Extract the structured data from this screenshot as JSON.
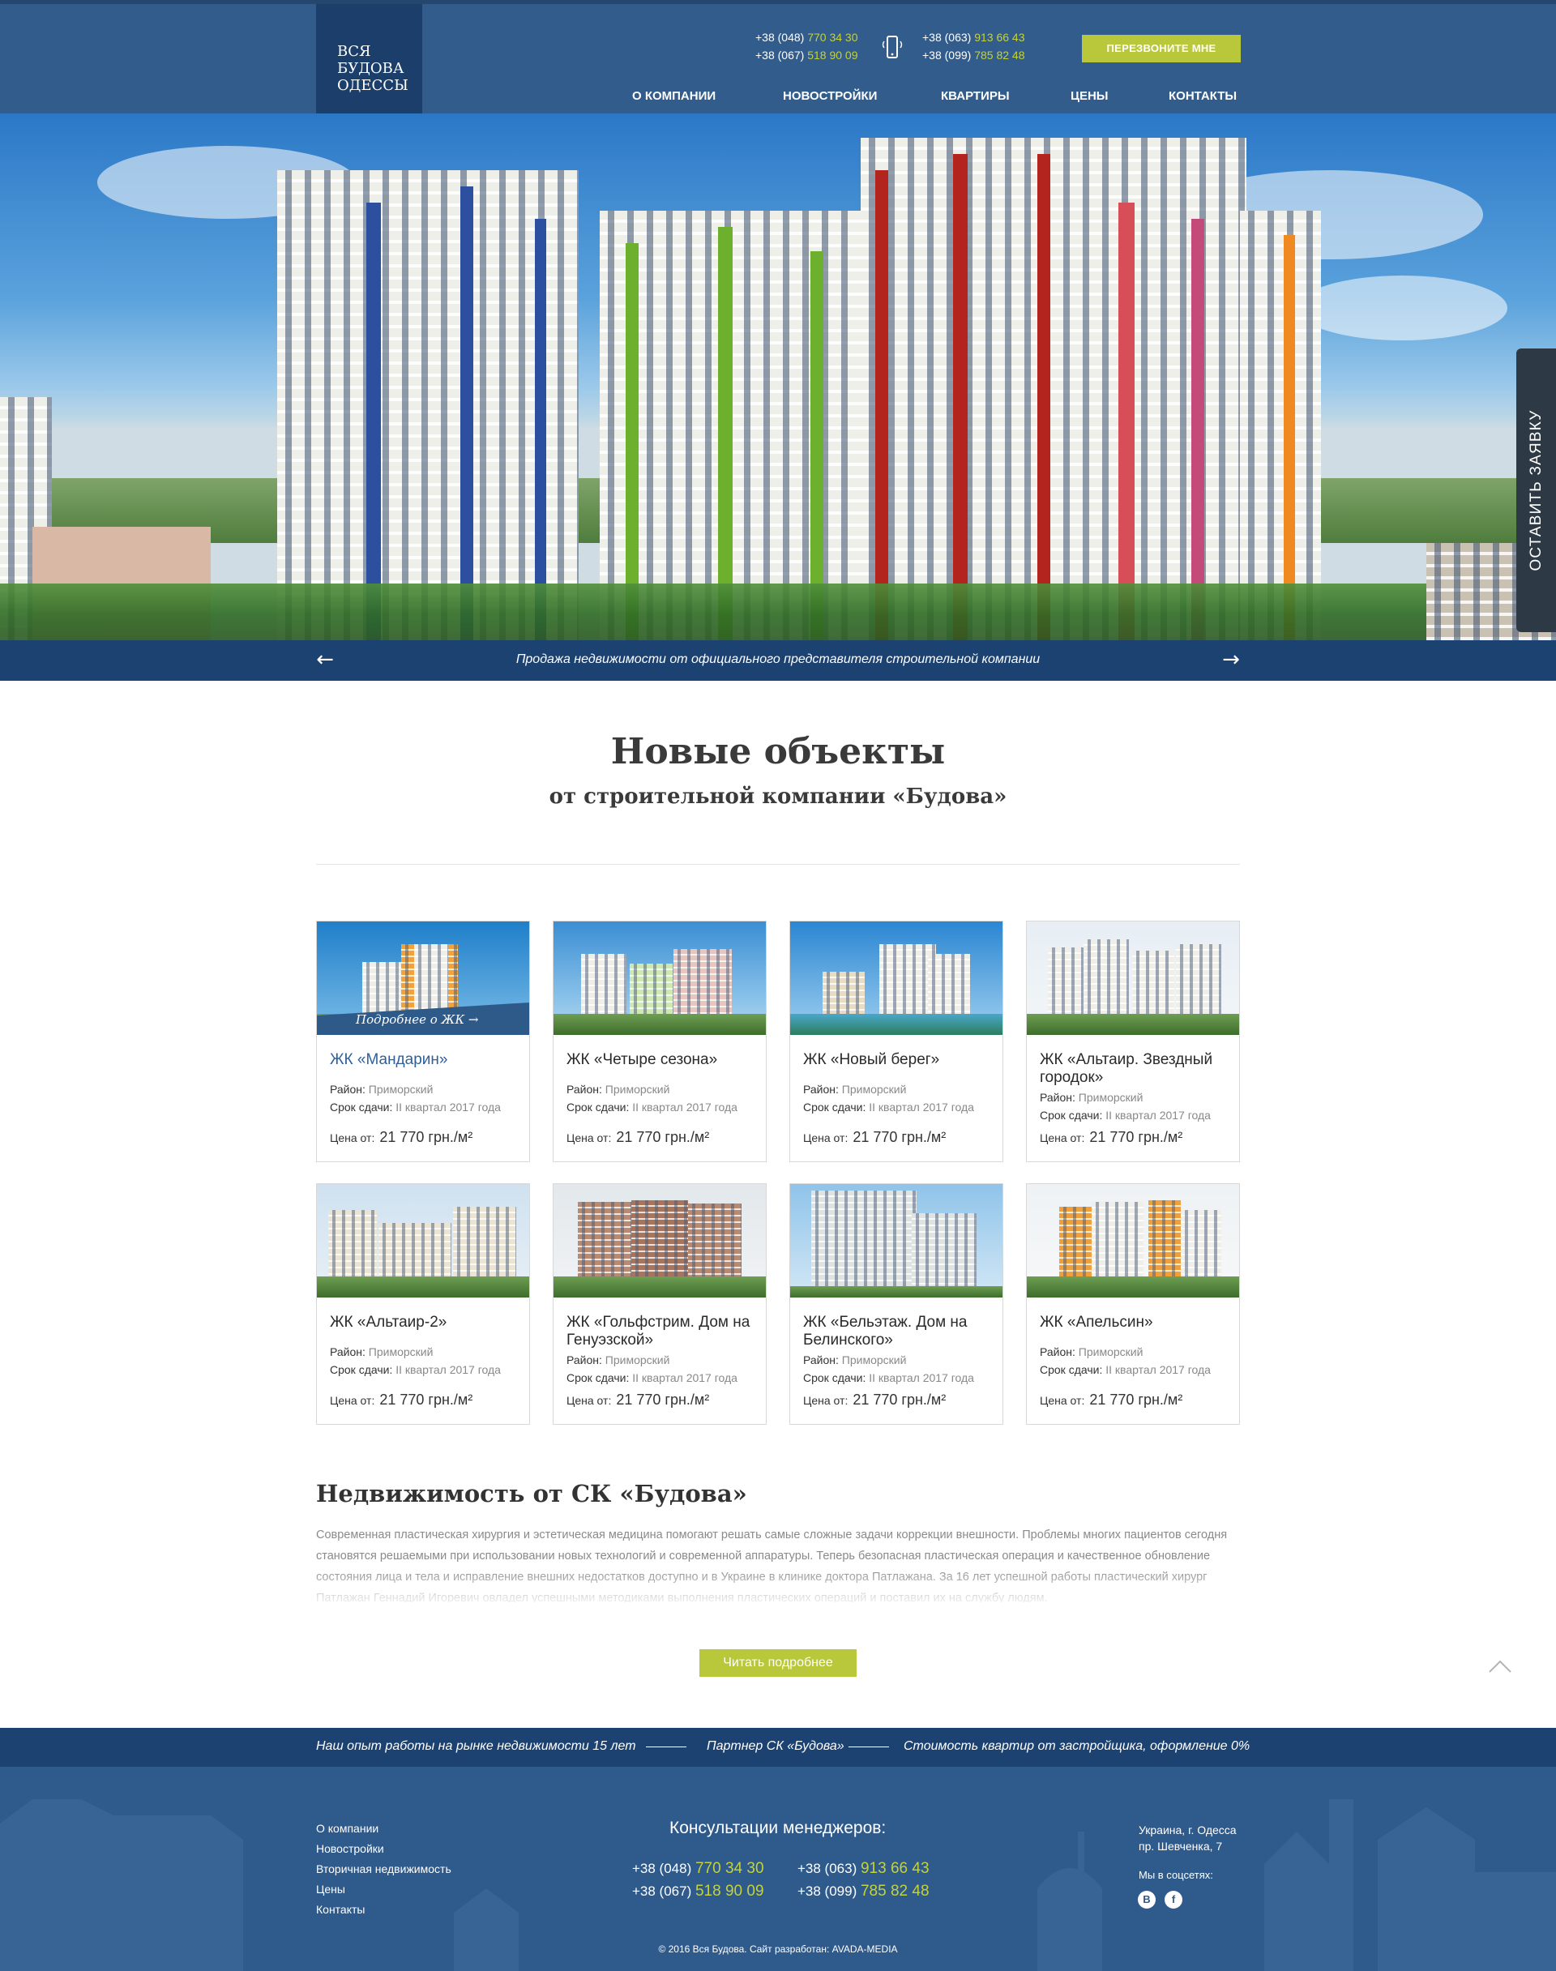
{
  "header": {
    "logo_lines": [
      "ВСЯ",
      "БУДОВА",
      "ОДЕССЫ"
    ],
    "phones_left": [
      {
        "code": "+38 (048)",
        "number": "770 34 30"
      },
      {
        "code": "+38 (067)",
        "number": "518 90 09"
      }
    ],
    "phones_right": [
      {
        "code": "+38 (063)",
        "number": "913 66 43"
      },
      {
        "code": "+38 (099)",
        "number": "785 82 48"
      }
    ],
    "callback_label": "ПЕРЕЗВОНИТЕ МНЕ",
    "nav": [
      {
        "label": "О КОМПАНИИ",
        "active": true
      },
      {
        "label": "НОВОСТРОЙКИ",
        "active": false
      },
      {
        "label": "КВАРТИРЫ",
        "active": false
      },
      {
        "label": "ЦЕНЫ",
        "active": false
      },
      {
        "label": "КОНТАКТЫ",
        "active": false
      }
    ]
  },
  "hero": {
    "caption": "Продажа недвижимости от официального представителя строительной компании",
    "prev_icon": "arrow-left-icon",
    "next_icon": "arrow-right-icon",
    "side_tab": "ОСТАВИТЬ ЗАЯВКУ"
  },
  "objects": {
    "title": "Новые объекты",
    "subtitle": "от строительной компании «Будова»",
    "more_label": "Подробнее о ЖК",
    "district_label": "Район:",
    "deadline_label": "Срок сдачи:",
    "price_label": "Цена от:",
    "cards": [
      {
        "title": "ЖК «Мандарин»",
        "district": "Приморский",
        "deadline": "II квартал 2017 года",
        "price": "21 770 грн./м²"
      },
      {
        "title": "ЖК «Четыре сезона»",
        "district": "Приморский",
        "deadline": "II квартал 2017 года",
        "price": "21 770 грн./м²"
      },
      {
        "title": "ЖК «Новый берег»",
        "district": "Приморский",
        "deadline": "II квартал 2017 года",
        "price": "21 770 грн./м²"
      },
      {
        "title": "ЖК «Альтаир. Звездный городок»",
        "district": "Приморский",
        "deadline": "II квартал 2017 года",
        "price": "21 770 грн./м²"
      },
      {
        "title": "ЖК «Альтаир-2»",
        "district": "Приморский",
        "deadline": "II квартал 2017 года",
        "price": "21 770 грн./м²"
      },
      {
        "title": "ЖК «Гольфстрим. Дом на Генуэзской»",
        "district": "Приморский",
        "deadline": "II квартал 2017 года",
        "price": "21 770 грн./м²"
      },
      {
        "title": "ЖК «Бельэтаж. Дом на Белинского»",
        "district": "Приморский",
        "deadline": "II квартал 2017 года",
        "price": "21 770 грн./м²"
      },
      {
        "title": "ЖК «Апельсин»",
        "district": "Приморский",
        "deadline": "II квартал 2017 года",
        "price": "21 770 грн./м²"
      }
    ]
  },
  "about": {
    "title": "Недвижимость от СК «Будова»",
    "text": "Современная пластическая хирургия и эстетическая медицина помогают решать самые сложные задачи коррекции внешности. Проблемы многих пациентов сегодня становятся решаемыми при использовании новых технологий и современной аппаратуры. Теперь безопасная пластическая операция и качественное обновление состояния лица и тела и исправление внешних недостатков доступно и в Украине в клинике доктора Патлажана. За 16 лет успешной работы пластический хирург Патлажан Геннадий Игоревич овладел успешными методиками выполнения пластических операций и поставил их на службу людям.",
    "read_more": "Читать подробнее"
  },
  "facts": [
    "Наш опыт работы на рынке недвижимости 15 лет",
    "Партнер СК «Будова»",
    "Стоимость квартир от застройщика, оформление 0%"
  ],
  "footer": {
    "links": [
      "О компании",
      "Новостройки",
      "Вторичная недвижимость",
      "Цены",
      "Контакты"
    ],
    "consult_title": "Консультации менеджеров:",
    "address_lines": [
      "Украина, г. Одесса",
      "пр. Шевченка, 7"
    ],
    "social_label": "Мы в соцсетях:",
    "social": [
      {
        "glyph": "В",
        "icon": "vk-icon"
      },
      {
        "glyph": "f",
        "icon": "facebook-icon"
      }
    ],
    "copyright": "© 2016 Вся Будова. Сайт разработан: AVADA-MEDIA"
  },
  "colors": {
    "header_bg": "#315c8c",
    "logo_bg": "#1b3f6a",
    "accent": "#b9c73b",
    "dark_bar": "#1c4272",
    "side_tab_bg": "#2d3a45"
  }
}
